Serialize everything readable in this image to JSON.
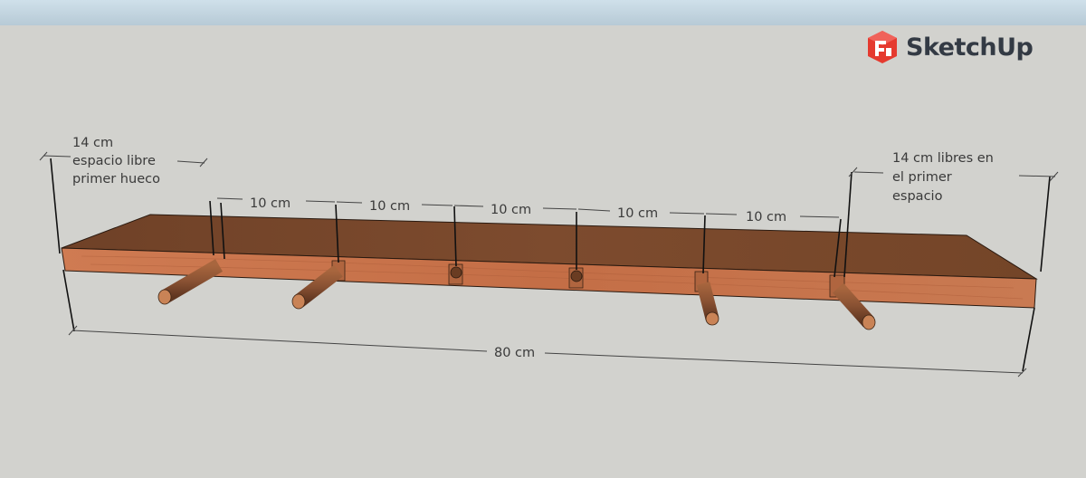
{
  "brand": {
    "name": "SketchUp",
    "logo_icon": "sketchup-logo-icon",
    "logo_color": "#e53a2f"
  },
  "colors": {
    "background": "#d2d2ce",
    "shelf_top": "#7a4a2e",
    "shelf_front": "#c8734a",
    "dowel": "#8a5233"
  },
  "annotations": {
    "left_note": [
      "14 cm",
      "espacio libre",
      "primer hueco"
    ],
    "right_note": [
      "14 cm libres en",
      "el primer",
      "espacio"
    ],
    "spacings": [
      "10 cm",
      "10 cm",
      "10 cm",
      "10 cm",
      "10 cm"
    ],
    "total_length": "80 cm"
  }
}
